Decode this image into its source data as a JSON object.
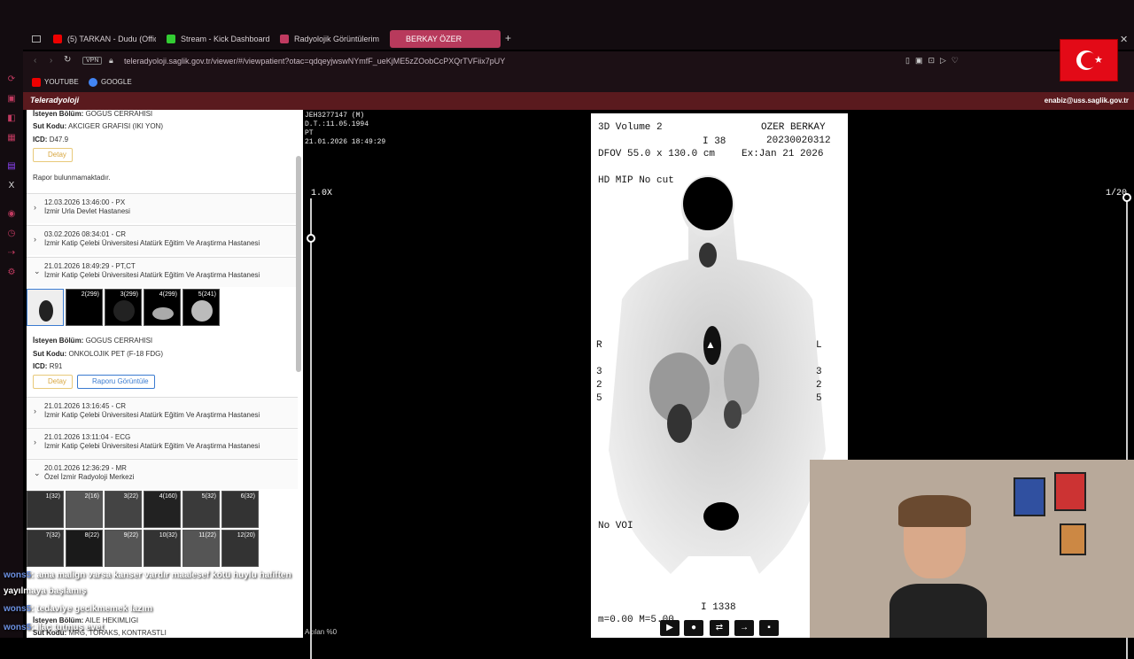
{
  "browser": {
    "tabs": [
      {
        "label": "(5) TARKAN - Dudu (Offic",
        "icon_color": "#e00"
      },
      {
        "label": "Stream - Kick Dashboard",
        "icon_color": "#3c3"
      },
      {
        "label": "Radyolojik Görüntülerim",
        "icon_color": "#c03a60"
      },
      {
        "label": "BERKAY ÖZER",
        "icon_color": "#fff"
      }
    ],
    "url": "teleradyoloji.saglik.gov.tr/viewer/#/viewpatient?otac=qdqeyjwswNYmfF_ueKjME5zZOobCcPXQrTVFiix7pUY",
    "vpn": "VPN",
    "bookmarks": [
      "YOUTUBE",
      "GOOGLE"
    ]
  },
  "app": {
    "logo": "Teleradyoloji",
    "user": "enabiz@uss.saglik.gov.tr"
  },
  "panel": {
    "top_requesting": {
      "label": "İsteyen Bölüm:",
      "value": "GOGUS CERRAHISI"
    },
    "top_code": {
      "label": "Sut Kodu:",
      "value": "AKCIGER GRAFISI (IKI YON)"
    },
    "top_icd": {
      "label": "ICD:",
      "value": "D47.9"
    },
    "detail_label": "Detay",
    "no_report": "Rapor bulunmamaktadır.",
    "studies_a": [
      {
        "date": "12.03.2026 13:46:00 - PX",
        "place": "İzmir Urla Devlet Hastanesi",
        "chev": "›"
      },
      {
        "date": "03.02.2026 08:34:01 - CR",
        "place": "İzmir Katip Çelebi Üniversitesi Atatürk Eğitim Ve Araştirma Hastanesi",
        "chev": "›"
      },
      {
        "date": "21.01.2026 18:49:29 - PT,CT",
        "place": "İzmir Katip Çelebi Üniversitesi Atatürk Eğitim Ve Araştirma Hastanesi",
        "chev": "⌄"
      }
    ],
    "pet_thumbs": [
      "",
      "2(299)",
      "3(299)",
      "4(299)",
      "5(241)"
    ],
    "mid_requesting": {
      "label": "İsteyen Bölüm:",
      "value": "GOGUS CERRAHISI"
    },
    "mid_code": {
      "label": "Sut Kodu:",
      "value": "ONKOLOJIK PET (F-18 FDG)"
    },
    "mid_icd": {
      "label": "ICD:",
      "value": "R91"
    },
    "report_label": "Raporu Görüntüle",
    "studies_b": [
      {
        "date": "21.01.2026 13:16:45 - CR",
        "place": "İzmir Katip Çelebi Üniversitesi Atatürk Eğitim Ve Araştirma Hastanesi",
        "chev": "›"
      },
      {
        "date": "21.01.2026 13:11:04 - ECG",
        "place": "İzmir Katip Çelebi Üniversitesi Atatürk Eğitim Ve Araştirma Hastanesi",
        "chev": "›"
      },
      {
        "date": "20.01.2026 12:36:29 - MR",
        "place": "Özel İzmir Radyoloji Merkezi",
        "chev": "⌄"
      }
    ],
    "mr_thumbs": [
      "1(32)",
      "2(16)",
      "3(22)",
      "4(160)",
      "5(32)",
      "6(32)",
      "7(32)",
      "8(22)",
      "9(22)",
      "10(32)",
      "11(22)",
      "12(20)"
    ],
    "bottom_requesting": {
      "label": "İsteyen Bölüm:",
      "value": "AILE HEKIMLIGI"
    },
    "bottom_code": {
      "label": "Sut Kodu:",
      "value": "MRG, TORAKS, KONTRASTLI"
    }
  },
  "viewer": {
    "patient_id": "JEH3277147 (M)",
    "birth": "D.T.:11.05.1994",
    "modality": "PT",
    "study_time": "21.01.2026 18:49:29",
    "zoom": "1.0X",
    "frame": "1/20",
    "opacity": "Açılan %0",
    "pet": {
      "title": "3D Volume 2",
      "patient": "OZER BERKAY",
      "id": "20230020312",
      "slice": "I 38",
      "dfov": "DFOV 55.0 x 130.0 cm",
      "exam": "Ex:Jan 21 2026",
      "mode": "HD MIP No cut",
      "right": "R",
      "left": "L",
      "num_l": [
        "3",
        "2",
        "5"
      ],
      "num_r": [
        "3",
        "2",
        "5"
      ],
      "voi": "No VOI",
      "bottom_i": "I 1338",
      "bottom_m": "m=0.00 M=5.00"
    }
  },
  "chat": [
    {
      "nick": "wons5",
      "text": ": ama malign varsa kanser vardır maalesef kötü huylu hafiften"
    },
    {
      "nick": "",
      "text": "yayılmaya başlamış"
    },
    {
      "nick": "wons5",
      "text": ": tedaviye gecikmemek lazım"
    },
    {
      "nick": "wons5",
      "text": ": ilaç tutmuş evet"
    }
  ]
}
